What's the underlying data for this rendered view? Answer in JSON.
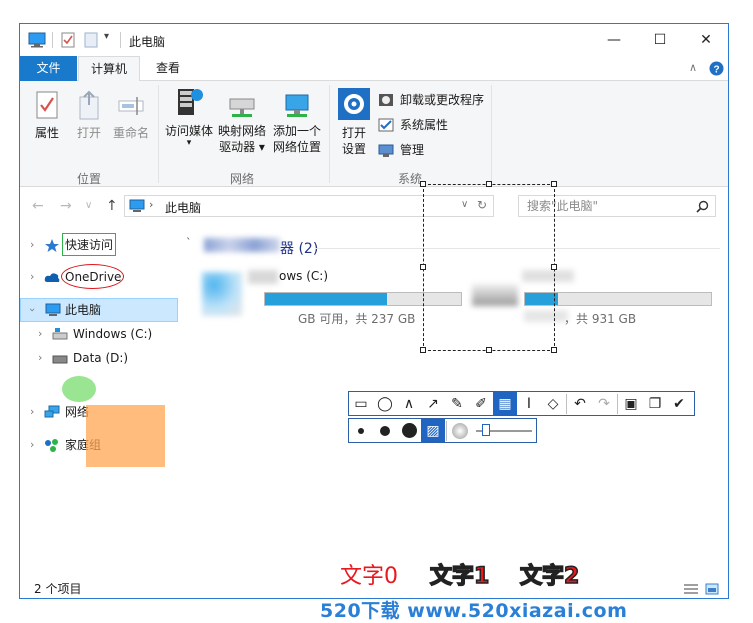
{
  "window": {
    "title": "此电脑"
  },
  "tabs": {
    "file": "文件",
    "computer": "计算机",
    "view": "查看"
  },
  "ribbon": {
    "location": {
      "label": "位置",
      "properties": "属性",
      "open": "打开",
      "rename": "重命名"
    },
    "network": {
      "label": "网络",
      "access_media": "访问媒体",
      "map_drive_1": "映射网络",
      "map_drive_2": "驱动器",
      "add_location_1": "添加一个",
      "add_location_2": "网络位置"
    },
    "system": {
      "label": "系统",
      "open_settings_1": "打开",
      "open_settings_2": "设置",
      "uninstall": "卸载或更改程序",
      "sys_props": "系统属性",
      "manage": "管理"
    }
  },
  "address": {
    "path": "此电脑",
    "search_placeholder": "搜索\"此电脑\""
  },
  "nav": {
    "quick_access": "快速访问",
    "onedrive": "OneDrive",
    "this_pc": "此电脑",
    "windows_c": "Windows (C:)",
    "data_d": "Data (D:)",
    "network": "网络",
    "homegroup": "家庭组"
  },
  "content": {
    "group_header": "器 (2)",
    "drive_c_name": "ows (C:)",
    "drive_c_info": "GB 可用，共 237 GB",
    "drive_c_used": 0.62,
    "drive_d_info": "，共 931 GB",
    "drive_d_used": 0.18
  },
  "status": {
    "items": "2 个项目"
  },
  "annotations": {
    "text0": "文字0",
    "text1": "文字1",
    "text2": "文字2"
  },
  "watermark": "520下载 www.520xiazai.com",
  "colors": {
    "accent": "#1979ca",
    "annot_red": "#e8191e",
    "annot_green": "#2db34a"
  }
}
